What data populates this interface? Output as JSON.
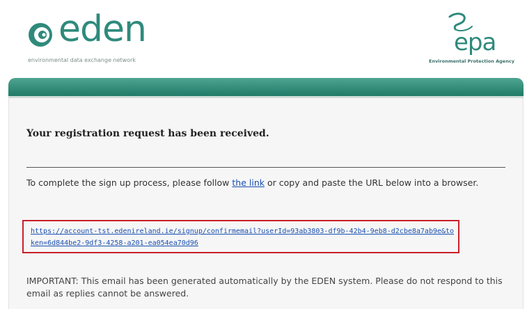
{
  "header": {
    "eden_logo_text": "eden",
    "eden_tagline": "environmental data exchange network",
    "epa_logo_text": "epa",
    "epa_tagline": "Environmental Protection Agency"
  },
  "colors": {
    "brand_green": "#2f8a7c",
    "band_green": "#3a9a85",
    "link_blue": "#1a4fb0",
    "highlight_red": "#c9202a"
  },
  "message": {
    "heading": "Your registration request has been received.",
    "instruction_before": "To complete the sign up process, please follow ",
    "link_label": "the link",
    "instruction_after": " or copy and paste the URL below into a browser.",
    "url": "https://account-tst.edenireland.ie/signup/confirmemail?userId=93ab3803-df9b-42b4-9eb8-d2cbe8a7ab9e&token=6d844be2-9df3-4258-a201-ea054ea70d96",
    "important_note": "IMPORTANT: This email has been generated automatically by the EDEN system. Please do not respond to this email as replies cannot be answered."
  }
}
